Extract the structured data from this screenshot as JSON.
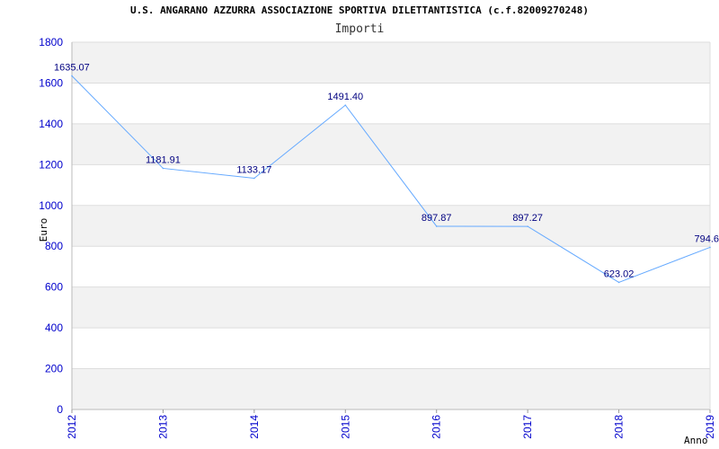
{
  "chart_data": {
    "type": "line",
    "title": "U.S. ANGARANO AZZURRA ASSOCIAZIONE SPORTIVA DILETTANTISTICA (c.f.82009270248)",
    "subtitle": "Importi",
    "xlabel": "Anno",
    "ylabel": "Euro",
    "x": [
      "2012",
      "2013",
      "2014",
      "2015",
      "2016",
      "2017",
      "2018",
      "2019"
    ],
    "series": [
      {
        "name": "",
        "values": [
          1635.07,
          1181.91,
          1133.17,
          1491.4,
          897.87,
          897.27,
          623.02,
          794.6
        ],
        "labels": [
          "1635.07",
          "1181.91",
          "1133.17",
          "1491.40",
          "897.87",
          "897.27",
          "623.02",
          "794.6"
        ]
      }
    ],
    "ylim": [
      0,
      1800
    ],
    "yticks": [
      0,
      200,
      400,
      600,
      800,
      1000,
      1200,
      1400,
      1600,
      1800
    ],
    "grid": true,
    "colors": {
      "line": "#66aaff",
      "band": "#f2f2f2",
      "grid": "#dddddd",
      "tick": "#0000cc",
      "label": "#000080"
    }
  }
}
